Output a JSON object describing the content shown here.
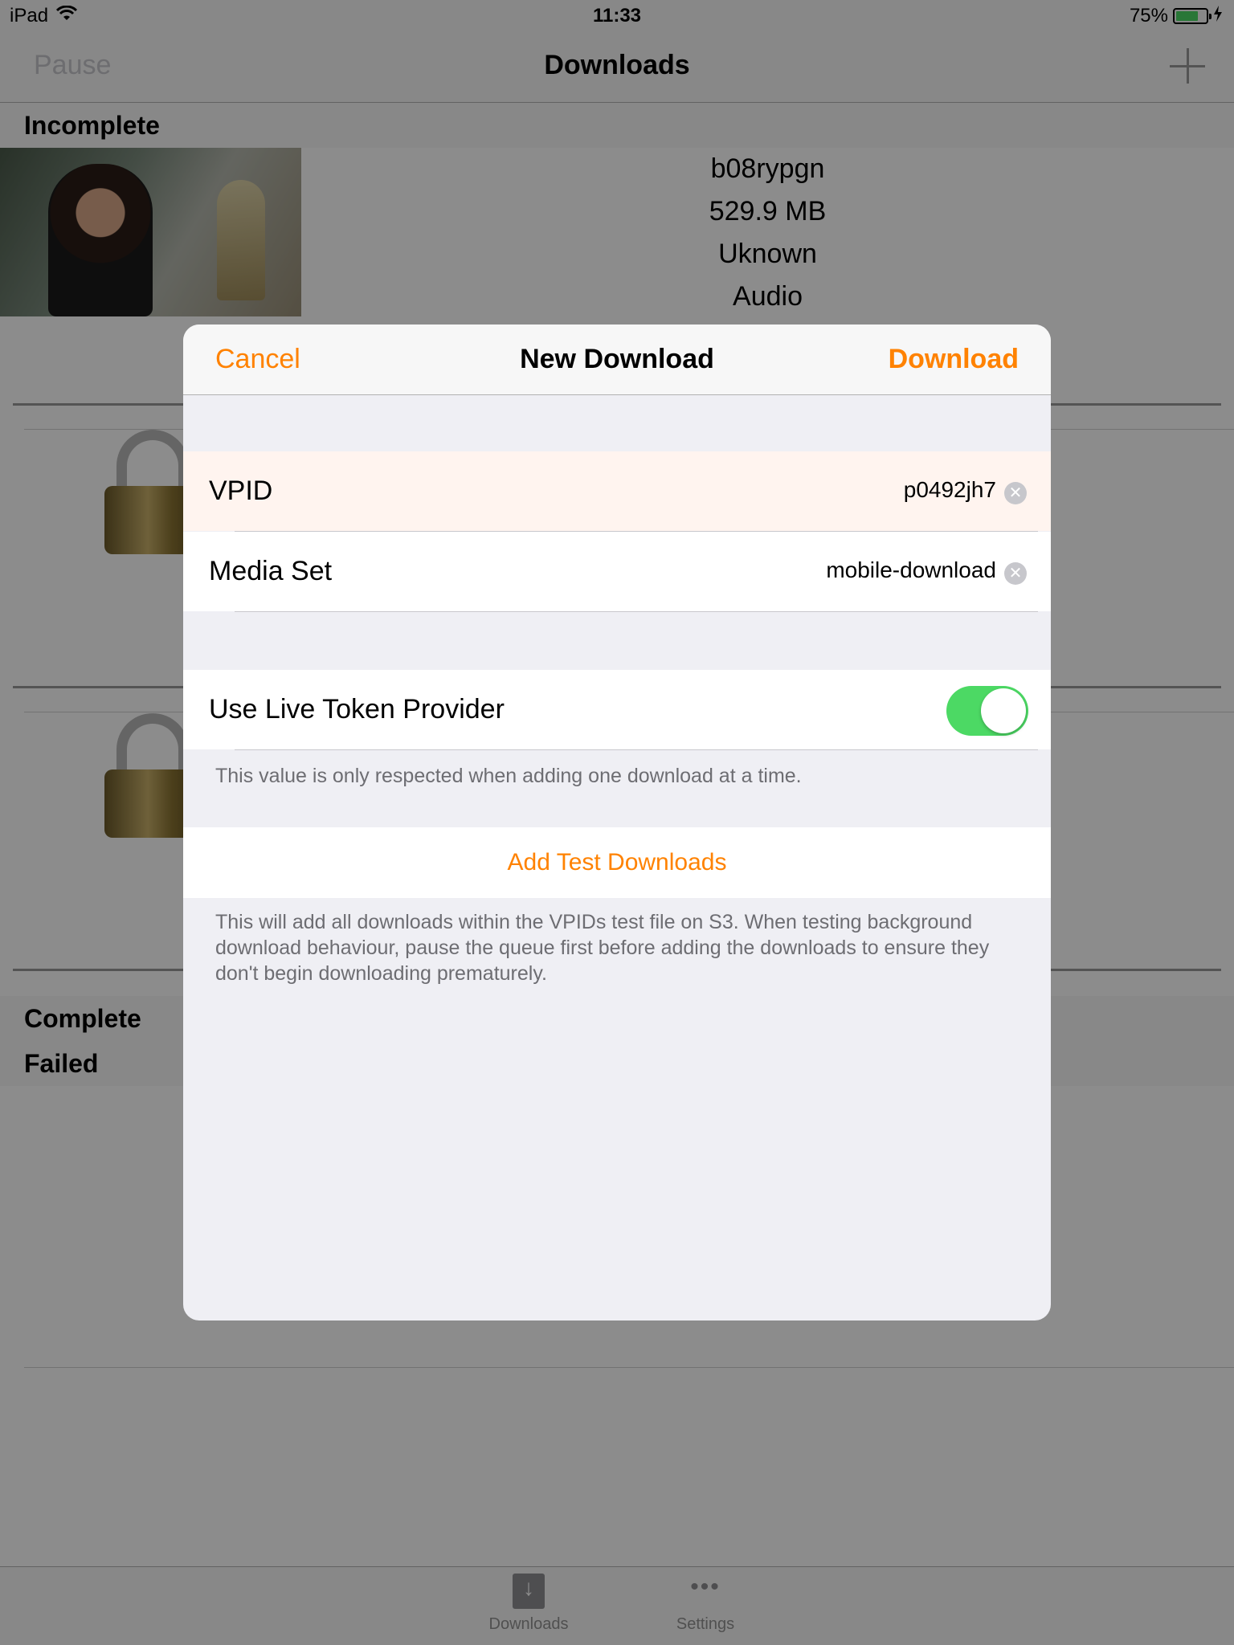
{
  "status_bar": {
    "device": "iPad",
    "time": "11:33",
    "battery_percent_text": "75%",
    "battery_level": 0.75,
    "icons": [
      "wifi-icon",
      "battery-icon",
      "charging-icon"
    ]
  },
  "nav": {
    "left_button": "Pause",
    "title": "Downloads",
    "right_icon": "plus-icon"
  },
  "sections": {
    "incomplete": "Incomplete",
    "complete": "Complete",
    "failed": "Failed"
  },
  "incomplete_item": {
    "id": "b08rypgn",
    "size": "529.9 MB",
    "status": "Uknown",
    "kind": "Audio"
  },
  "tab_bar": {
    "downloads": "Downloads",
    "settings": "Settings",
    "downloads_icon": "download-arrow-icon",
    "settings_icon": "ellipsis-icon"
  },
  "modal": {
    "cancel": "Cancel",
    "title": "New Download",
    "download": "Download",
    "vpid_label": "VPID",
    "vpid_value": "p0492jh7",
    "media_set_label": "Media Set",
    "media_set_value": "mobile-download",
    "live_token_label": "Use Live Token Provider",
    "live_token_on": true,
    "live_token_footer": "This value is only respected when adding one download at a time.",
    "add_test": "Add Test Downloads",
    "add_test_footer": "This will add all downloads within the VPIDs test file on S3. When testing background download behaviour, pause the queue first before adding the downloads to ensure they don't begin downloading prematurely."
  },
  "colors": {
    "accent": "#ff8200",
    "toggle_on": "#4cd964",
    "highlight_row": "#fff4ef"
  }
}
